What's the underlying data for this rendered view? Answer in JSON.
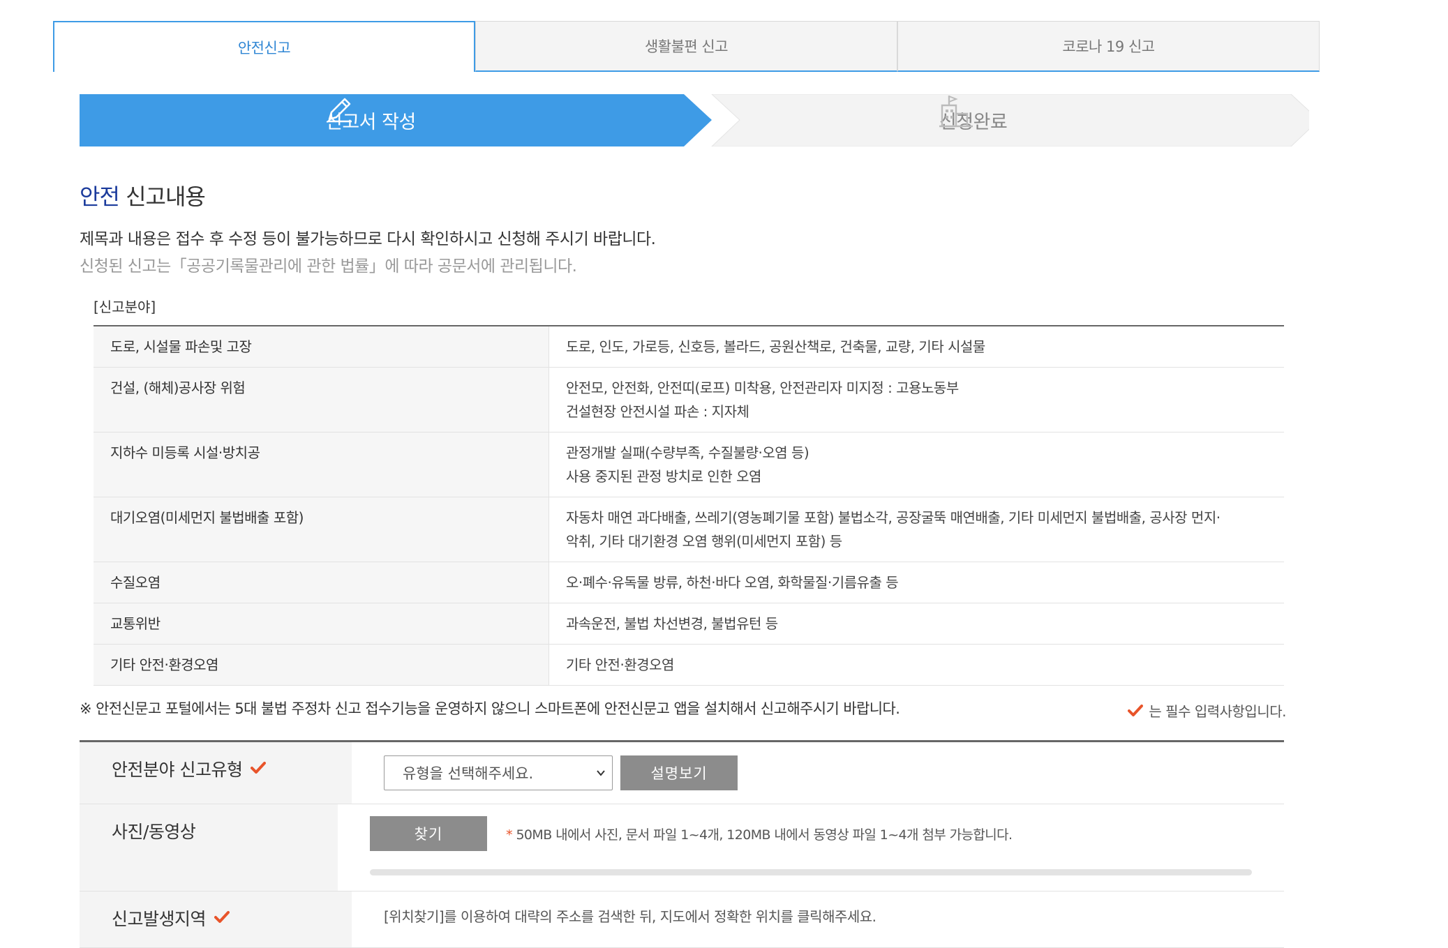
{
  "tabs": [
    {
      "label": "안전신고",
      "active": true
    },
    {
      "label": "생활불편 신고",
      "active": false
    },
    {
      "label": "코로나 19 신고",
      "active": false
    }
  ],
  "steps": [
    {
      "label": "신고서 작성",
      "icon": "pencil-icon",
      "active": true
    },
    {
      "label": "신청완료",
      "icon": "building-icon",
      "active": false
    }
  ],
  "section": {
    "title_highlight": "안전",
    "title_rest": " 신고내용",
    "notice_main": "제목과 내용은 접수 후 수정 등이 불가능하므로 다시 확인하시고 신청해 주시기 바랍니다.",
    "notice_sub": "신청된 신고는「공공기록물관리에 관한 법률」에 따라 공문서에 관리됩니다."
  },
  "category": {
    "label": "[신고분야]",
    "rows": [
      {
        "name": "도로, 시설물 파손및 고장",
        "desc": [
          "도로, 인도, 가로등, 신호등, 볼라드, 공원산책로, 건축물, 교량, 기타 시설물"
        ]
      },
      {
        "name": "건설, (해체)공사장 위험",
        "desc": [
          "안전모, 안전화, 안전띠(로프) 미착용, 안전관리자 미지정 : 고용노동부",
          "건설현장 안전시설 파손 : 지자체"
        ]
      },
      {
        "name": "지하수 미등록 시설·방치공",
        "desc": [
          "관정개발 실패(수량부족, 수질불량·오염 등)",
          "사용 중지된 관정 방치로 인한 오염"
        ]
      },
      {
        "name": "대기오염(미세먼지 불법배출 포함)",
        "desc": [
          "자동차 매연 과다배출, 쓰레기(영농폐기물 포함) 불법소각, 공장굴뚝 매연배출, 기타 미세먼지 불법배출, 공사장 먼지·",
          "악취, 기타 대기환경 오염 행위(미세먼지 포함) 등"
        ]
      },
      {
        "name": "수질오염",
        "desc": [
          "오·폐수·유독물 방류, 하천·바다 오염, 화학물질·기름유출 등"
        ]
      },
      {
        "name": "교통위반",
        "desc": [
          "과속운전, 불법 차선변경, 불법유턴 등"
        ]
      },
      {
        "name": "기타 안전·환경오염",
        "desc": [
          "기타 안전·환경오염"
        ]
      }
    ]
  },
  "warning": "※ 안전신문고 포털에서는 5대 불법 주정차 신고 접수기능을 운영하지 않으니 스마트폰에 안전신문고 앱을 설치해서 신고해주시기 바랍니다.",
  "required_note": "는 필수 입력사항입니다.",
  "colors": {
    "accent": "#3e9be6",
    "check": "#e8542a",
    "highlight": "#1b3b9c"
  },
  "form": {
    "type_label": "안전분야 신고유형",
    "type_select_value": "유형을 선택해주세요.",
    "explain_button": "설명보기",
    "media_label": "사진/동영상",
    "find_button": "찾기",
    "media_hint_star": "*",
    "media_hint": " 50MB 내에서 사진, 문서 파일 1~4개, 120MB 내에서 동영상 파일 1~4개 첨부 가능합니다.",
    "region_label": "신고발생지역",
    "region_hint": "[위치찾기]를 이용하여 대략의 주소를 검색한 뒤, 지도에서 정확한 위치를 클릭해주세요."
  }
}
